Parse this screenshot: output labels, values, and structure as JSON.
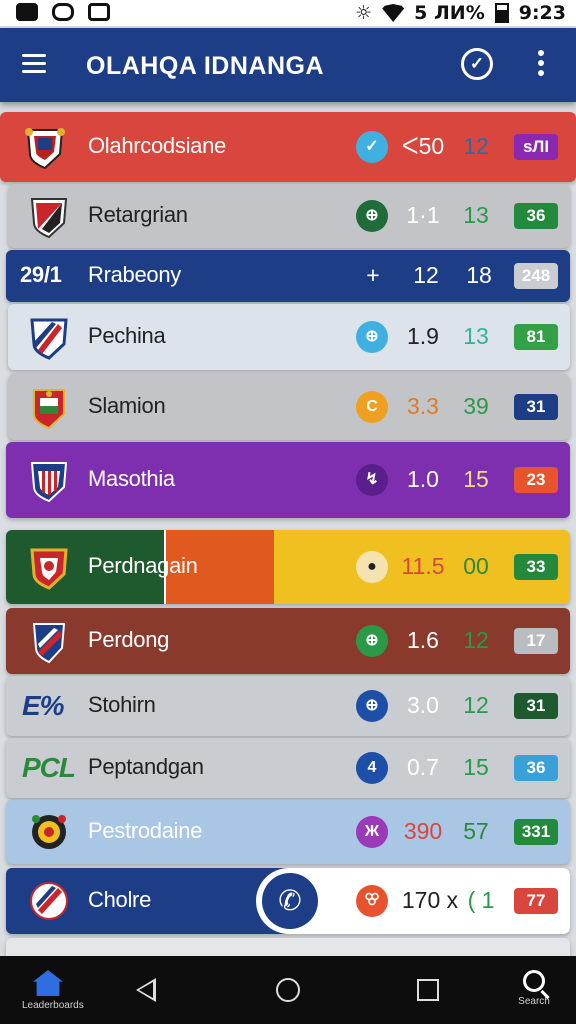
{
  "status_bar": {
    "battery_text": "5 ЛИ%",
    "time": "9:23"
  },
  "app_bar": {
    "title": "OLAHQA IDNANGA"
  },
  "rows": [
    {
      "team": "Olahrcodsiane",
      "badge_icon": "✓",
      "v1": "ᐸ50",
      "v2": "12",
      "pill": "ѕЛІ"
    },
    {
      "team": "Retargrian",
      "badge_icon": "⊕",
      "v1": "1·1",
      "v2": "13",
      "pill": "36"
    },
    {
      "rank": "29/1",
      "team": "Rrabeony",
      "badge_icon": "+",
      "v1": "12",
      "v2": "18",
      "pill": "248"
    },
    {
      "team": "Pechina",
      "badge_icon": "⊕",
      "v1": "1.9",
      "v2": "13",
      "pill": "81"
    },
    {
      "team": "Slamion",
      "badge_icon": "C",
      "v1": "3.3",
      "v2": "39",
      "pill": "31"
    },
    {
      "team": "Masothia",
      "badge_icon": "↯",
      "v1": "1.0",
      "v2": "15",
      "pill": "23"
    },
    {
      "team": "Perdnagain",
      "badge_icon": "●",
      "v1": "11.5",
      "v2": "00",
      "pill": "33"
    },
    {
      "team": "Perdong",
      "badge_icon": "⊕",
      "v1": "1.6",
      "v2": "12",
      "pill": "17"
    },
    {
      "crest_text": "E%",
      "team": "Stohirn",
      "badge_icon": "⊕",
      "v1": "3.0",
      "v2": "12",
      "pill": "31"
    },
    {
      "crest_text": "PCL",
      "team": "Peptandgan",
      "badge_icon": "4",
      "v1": "0.7",
      "v2": "15",
      "pill": "36"
    },
    {
      "team": "Pestrodaine",
      "badge_icon": "Ж",
      "v1": "390",
      "v2": "57",
      "pill": "331"
    },
    {
      "team": "Cholre",
      "badge_icon": "ꕢ",
      "v1": "170 x",
      "v2": "( 1",
      "pill": "77"
    }
  ],
  "nav": {
    "home_label": "Leaderboards",
    "search_label": "Search"
  }
}
